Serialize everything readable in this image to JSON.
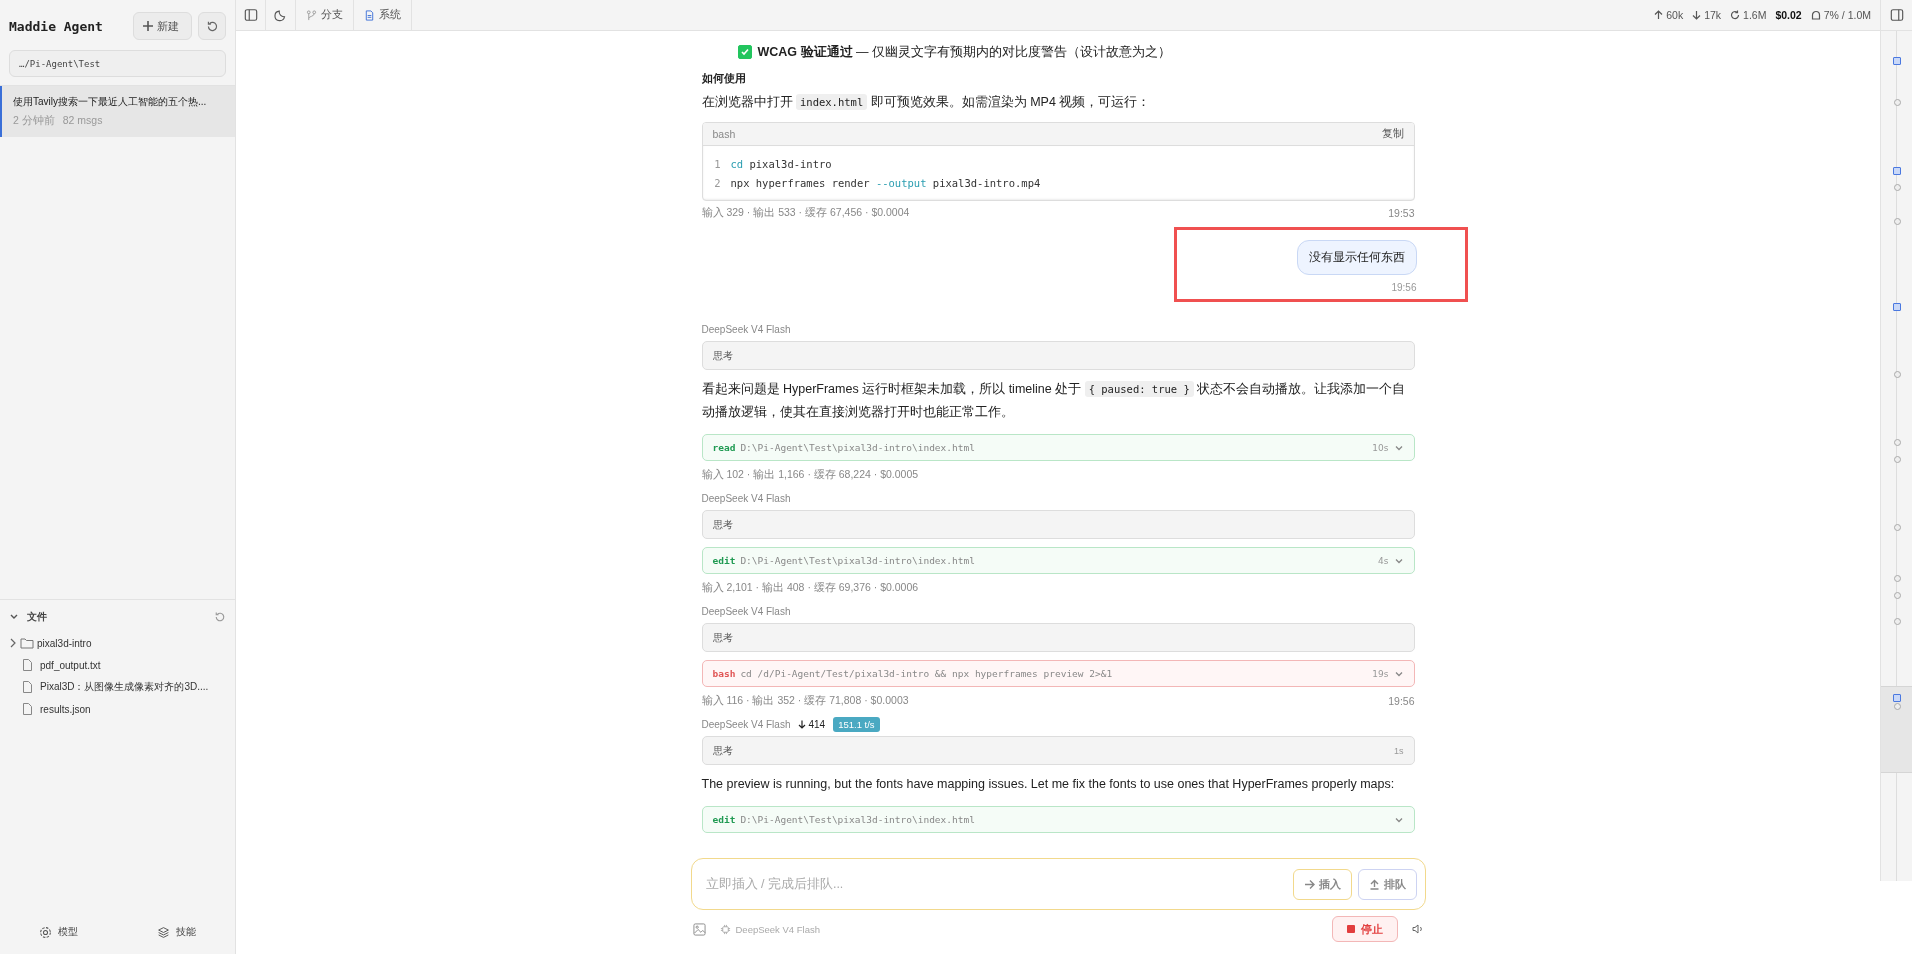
{
  "sidebar": {
    "title": "Maddie Agent",
    "new_button": "新建",
    "path": "…/Pi-Agent\\Test",
    "sessions": [
      {
        "title": "使用Tavily搜索一下最近人工智能的五个热...",
        "time": "2 分钟前",
        "count": "82 msgs",
        "selected": true
      }
    ],
    "files": {
      "title": "文件",
      "expanded": true,
      "items": [
        {
          "kind": "folder",
          "name": "pixal3d-intro",
          "expanded": false
        },
        {
          "kind": "file",
          "name": "pdf_output.txt"
        },
        {
          "kind": "file",
          "name": "Pixal3D：从图像生成像素对齐的3D...."
        },
        {
          "kind": "file",
          "name": "results.json"
        }
      ]
    },
    "footer": [
      {
        "kind": "model",
        "label": "模型"
      },
      {
        "kind": "skills",
        "label": "技能"
      }
    ]
  },
  "topbar": {
    "left": [
      {
        "kind": "branch",
        "label": "分支"
      },
      {
        "kind": "doc",
        "label": "系统"
      }
    ],
    "stats": [
      {
        "kind": "up",
        "text": "60k"
      },
      {
        "kind": "down",
        "text": "17k"
      },
      {
        "kind": "cache",
        "text": "1.6M"
      },
      {
        "kind": "cost",
        "text": "$0.02"
      },
      {
        "kind": "context",
        "text": "7% / 1.0M"
      }
    ]
  },
  "messages": [
    {
      "kind": "check",
      "checked": true,
      "text": "**WCAG 验证通过** — 仅幽灵文字有预期内的对比度警告（设计故意为之）"
    },
    {
      "kind": "heading",
      "text": "如何使用"
    },
    {
      "kind": "paragraph",
      "parts": [
        {
          "kind": "text",
          "text": "在浏览器中打开 "
        },
        {
          "kind": "code",
          "text": "index.html"
        },
        {
          "kind": "text",
          "text": " 即可预览效果。如需渲染为 MP4 视频，可运行："
        }
      ]
    },
    {
      "kind": "codeblock",
      "lang": "bash",
      "copy": "复制",
      "lines": [
        {
          "number": "1",
          "tokens": [
            {
              "kind": "cmd",
              "text": "cd"
            },
            {
              "kind": "plain",
              "text": " pixal3d-intro"
            }
          ]
        },
        {
          "number": "2",
          "tokens": [
            {
              "kind": "plain",
              "text": "npx hyperframes render "
            },
            {
              "kind": "cmd",
              "text": "--output"
            },
            {
              "kind": "plain",
              "text": " pixal3d-intro.mp4"
            }
          ]
        }
      ]
    },
    {
      "kind": "meta",
      "text": "输入 329 · 输出 533 · 缓存 67,456 · $0.0004",
      "time": "19:53"
    },
    {
      "kind": "user",
      "text": "没有显示任何东西",
      "time": "19:56",
      "highlighted": true
    },
    {
      "kind": "model",
      "name": "DeepSeek V4 Flash"
    },
    {
      "kind": "thinking",
      "label": "思考"
    },
    {
      "kind": "paragraph",
      "parts": [
        {
          "kind": "text",
          "text": "看起来问题是 HyperFrames 运行时框架未加载，所以 timeline 处于 "
        },
        {
          "kind": "code",
          "text": "{ paused: true }"
        },
        {
          "kind": "text",
          "text": " 状态不会自动播放。让我添加一个自动播放逻辑，使其在直接浏览器打开时也能正常工作。"
        }
      ]
    },
    {
      "kind": "tool",
      "tool": "read",
      "failed": false,
      "command": "D:\\Pi-Agent\\Test\\pixal3d-intro\\index.html",
      "duration": "10s"
    },
    {
      "kind": "meta",
      "text": "输入 102 · 输出 1,166 · 缓存 68,224 · $0.0005"
    },
    {
      "kind": "model",
      "name": "DeepSeek V4 Flash"
    },
    {
      "kind": "thinking",
      "label": "思考"
    },
    {
      "kind": "tool",
      "tool": "edit",
      "failed": false,
      "command": "D:\\Pi-Agent\\Test\\pixal3d-intro\\index.html",
      "duration": "4s"
    },
    {
      "kind": "meta",
      "text": "输入 2,101 · 输出 408 · 缓存 69,376 · $0.0006"
    },
    {
      "kind": "model",
      "name": "DeepSeek V4 Flash"
    },
    {
      "kind": "thinking",
      "label": "思考"
    },
    {
      "kind": "tool",
      "tool": "bash",
      "failed": true,
      "command": "cd /d/Pi-Agent/Test/pixal3d-intro && npx hyperframes preview 2>&1",
      "duration": "19s"
    },
    {
      "kind": "meta",
      "text": "输入 116 · 输出 352 · 缓存 71,808 · $0.0003",
      "time": "19:56"
    },
    {
      "kind": "model",
      "name": "DeepSeek V4 Flash",
      "tokens": "414",
      "speed": "151.1 t/s"
    },
    {
      "kind": "thinking",
      "label": "思考",
      "duration": "1s"
    },
    {
      "kind": "paragraph",
      "parts": [
        {
          "kind": "text",
          "text": "The preview is running, but the fonts have mapping issues. Let me fix the fonts to use ones that HyperFrames properly maps:"
        }
      ]
    },
    {
      "kind": "tool",
      "tool": "edit",
      "failed": false,
      "command": "D:\\Pi-Agent\\Test\\pixal3d-intro\\index.html"
    }
  ],
  "composer": {
    "placeholder": "立即插入 / 完成后排队...",
    "buttons": [
      {
        "kind": "insert",
        "label": "插入"
      },
      {
        "kind": "queue",
        "label": "排队"
      }
    ],
    "model": "DeepSeek V4 Flash",
    "stop": "停止"
  }
}
